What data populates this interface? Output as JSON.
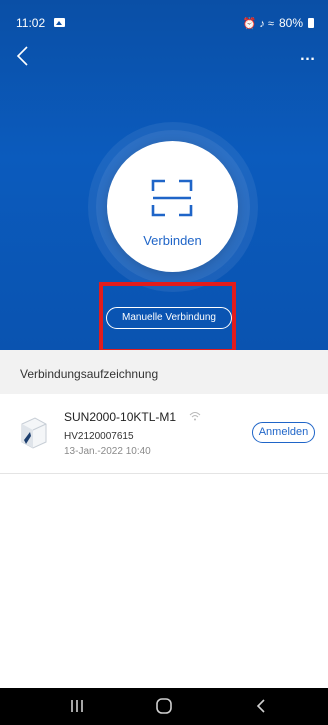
{
  "status_bar": {
    "time": "11:02",
    "indicators": "⏰ ♪ ≈",
    "battery": "80%"
  },
  "icons": {
    "back": "chevron-left-icon",
    "more": "more-dots-icon",
    "scan": "scan-frame-icon",
    "wifi": "wifi-icon",
    "device": "inverter-device-icon",
    "gallery": "gallery-notification-icon"
  },
  "header": {
    "more": "…"
  },
  "connect": {
    "label": "Verbinden"
  },
  "manual_connect": {
    "label": "Manuelle Verbindung"
  },
  "records": {
    "title": "Verbindungsaufzeichnung",
    "items": [
      {
        "name": "SUN2000-10KTL-M1",
        "serial": "HV2120007615",
        "date": "13-Jan.-2022 10:40",
        "action": "Anmelden"
      }
    ]
  },
  "colors": {
    "hero_blue": "#0a4fa6",
    "accent_blue": "#1f65c8",
    "highlight_red": "#e21c1c"
  }
}
